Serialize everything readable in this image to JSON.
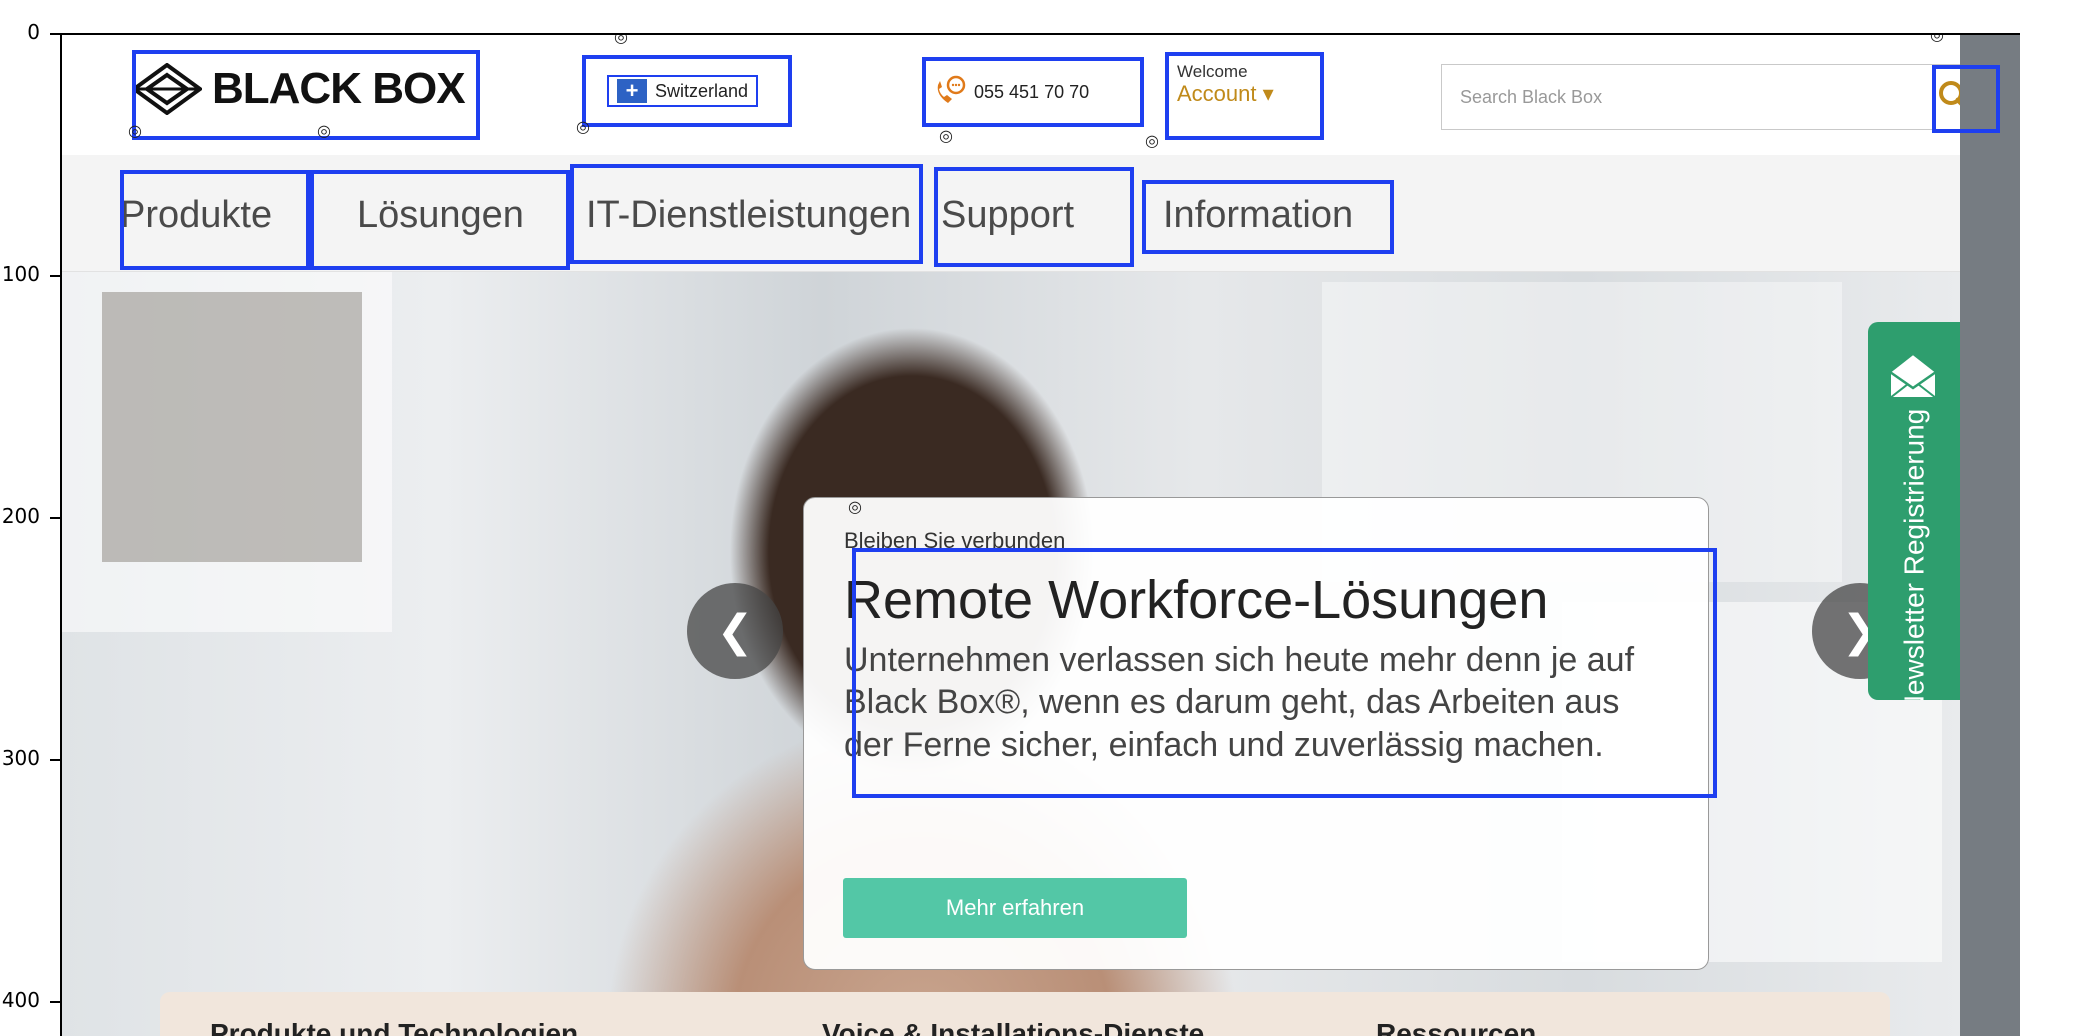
{
  "axis": {
    "y_ticks": [
      "0",
      "100",
      "200",
      "300",
      "400"
    ]
  },
  "header": {
    "logo_text": "BLACK BOX",
    "country_label": "Switzerland",
    "phone": "055 451 70 70",
    "welcome_label": "Welcome",
    "account_label": "Account ▾",
    "search": {
      "placeholder": "Search Black Box",
      "value": ""
    }
  },
  "nav": {
    "items": [
      "Produkte",
      "Lösungen",
      "IT-Dienstleistungen",
      "Support",
      "Information"
    ]
  },
  "hero": {
    "kicker": "Bleiben Sie verbunden",
    "title": "Remote Workforce-Lösungen",
    "text": "Unternehmen verlassen sich heute mehr denn je auf Black Box®, wenn es darum geht, das Arbeiten aus der Ferne sicher, einfach und zuverlässig machen.",
    "cta_label": "Mehr erfahren",
    "prev_label": "❮",
    "next_label": "❯"
  },
  "newsletter": {
    "label": "Newsletter Registrierung"
  },
  "bottom_strip": {
    "items": [
      "Produkte und Technologien",
      "Voice & Installations-Dienste",
      "Ressourcen"
    ]
  },
  "colors": {
    "accent_green": "#53c7a6",
    "newsletter_green": "#2e9e6e",
    "account_gold": "#c08a1a",
    "annotation_blue": "#1e3ff0"
  }
}
